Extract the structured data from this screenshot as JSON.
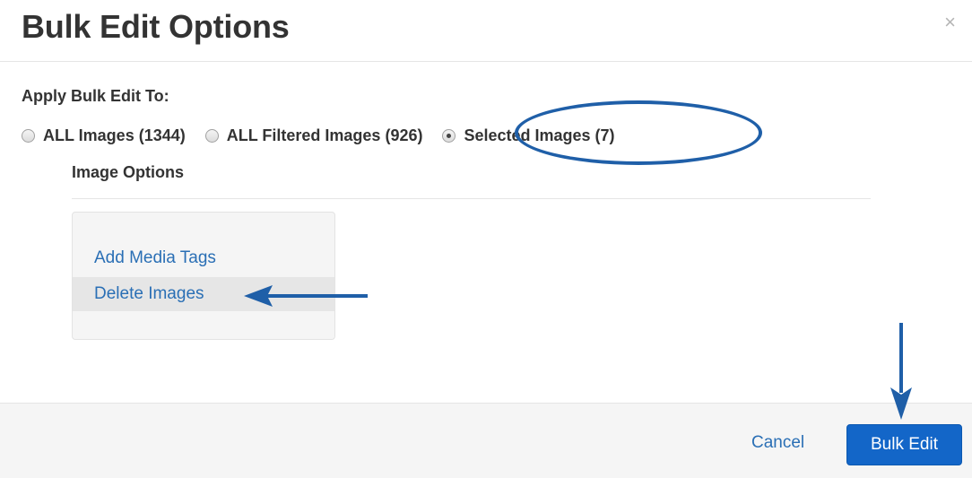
{
  "modal": {
    "title": "Bulk Edit Options",
    "close_glyph": "×"
  },
  "apply": {
    "label": "Apply Bulk Edit To:",
    "options": [
      {
        "label": "ALL Images (1344)",
        "selected": false
      },
      {
        "label": "ALL Filtered Images (926)",
        "selected": false
      },
      {
        "label": "Selected Images (7)",
        "selected": true
      }
    ]
  },
  "image_options": {
    "heading": "Image Options",
    "links": [
      {
        "label": "Add Media Tags"
      },
      {
        "label": "Delete Images"
      }
    ]
  },
  "footer": {
    "cancel_label": "Cancel",
    "submit_label": "Bulk Edit"
  },
  "colors": {
    "link": "#2a6fb5",
    "primary_button": "#1366c8",
    "annotation": "#1f5fa8"
  },
  "icons": {
    "close": "close-icon",
    "annotation_arrows": "arrow-icon"
  }
}
